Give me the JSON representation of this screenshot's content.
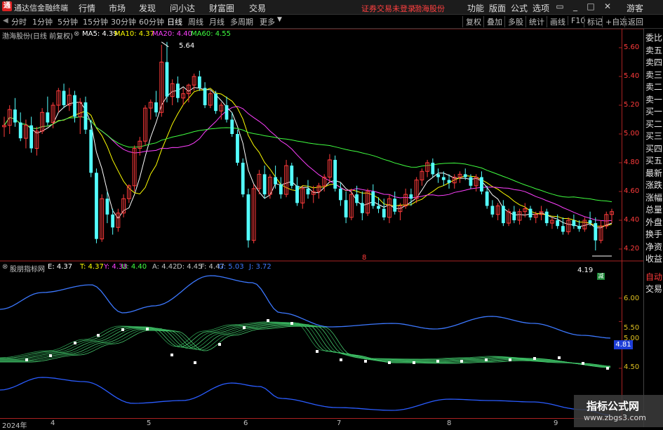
{
  "titlebar": {
    "logo": "通",
    "app_title": "通达信金融终端",
    "menus": [
      "行情",
      "市场",
      "发现",
      "问小达",
      "财富圈",
      "交易"
    ],
    "warning": "证券交易未登录",
    "stock_name": "渤海股份",
    "right_menus": [
      "功能",
      "版面",
      "公式",
      "选项"
    ],
    "guest": "游客"
  },
  "toolbar": {
    "periods": [
      "分时",
      "1分钟",
      "5分钟",
      "15分钟",
      "30分钟",
      "60分钟",
      "日线",
      "周线",
      "月线",
      "多周期",
      "更多"
    ],
    "active_period": "日线",
    "buttons": [
      "复权",
      "叠加",
      "多股",
      "统计",
      "画线",
      "F10",
      "标记",
      "+自选",
      "返回"
    ]
  },
  "main_chart": {
    "title": "渤海股份(日线 前复权)",
    "ma": [
      {
        "label": "MA5: 4.39",
        "color": "#ffffff"
      },
      {
        "label": "MA10: 4.37",
        "color": "#ffff00"
      },
      {
        "label": "MA20: 4.40",
        "color": "#ff40ff"
      },
      {
        "label": "MA60: 4.55",
        "color": "#40ff40"
      }
    ],
    "y_ticks": [
      "5.60",
      "5.40",
      "5.20",
      "5.00",
      "4.80",
      "4.60",
      "4.40",
      "4.20"
    ],
    "high_label": "5.64",
    "low_label": "4.19",
    "center_marker": "8"
  },
  "indicator": {
    "title": "股朋指标网",
    "values": [
      {
        "label": "E: 4.37",
        "color": "#ffffff"
      },
      {
        "label": "T: 4.37",
        "color": "#ffff00"
      },
      {
        "label": "Y: 4.38",
        "color": "#ff40ff"
      },
      {
        "label": "U: 4.40",
        "color": "#40ff40"
      },
      {
        "label": "A: 4.42",
        "color": "#c0c0c0"
      },
      {
        "label": "D: 4.45",
        "color": "#c0c0c0"
      },
      {
        "label": "F: 4.47",
        "color": "#c0c0c0"
      },
      {
        "label": "G: 5.03",
        "color": "#3c78ff"
      },
      {
        "label": "J: 3.72",
        "color": "#3c78ff"
      }
    ],
    "y_ticks": [
      "6.00",
      "5.50",
      "5.00",
      "4.50"
    ],
    "current": "4.81"
  },
  "right_panel": {
    "items": [
      "委比",
      "卖五",
      "卖四",
      "卖三",
      "卖二",
      "卖一",
      "买一",
      "买二",
      "买三",
      "买四",
      "买五",
      "最新",
      "涨跌",
      "涨幅",
      "总量",
      "外盘",
      "换手",
      "净资",
      "收益"
    ],
    "auto": "自动",
    "trade": "交易"
  },
  "dates": [
    {
      "label": "2024年"
    },
    {
      "label": "4"
    },
    {
      "label": "5"
    },
    {
      "label": "6"
    },
    {
      "label": "7"
    },
    {
      "label": "8"
    },
    {
      "label": "9"
    }
  ],
  "watermark": {
    "line1": "指标公式网",
    "line2": "www.zbgs3.com"
  },
  "candles": [
    [
      5.05,
      5.12,
      4.98,
      5.06
    ],
    [
      5.06,
      5.2,
      5.0,
      5.17
    ],
    [
      5.17,
      5.25,
      5.05,
      5.08
    ],
    [
      5.08,
      5.15,
      4.95,
      4.97
    ],
    [
      4.97,
      5.1,
      4.9,
      5.06
    ],
    [
      5.06,
      5.12,
      4.87,
      4.9
    ],
    [
      4.9,
      5.05,
      4.85,
      5.02
    ],
    [
      5.02,
      5.18,
      5.0,
      5.15
    ],
    [
      5.15,
      5.26,
      5.06,
      5.08
    ],
    [
      5.08,
      5.22,
      5.04,
      5.2
    ],
    [
      5.2,
      5.32,
      5.15,
      5.3
    ],
    [
      5.3,
      5.35,
      5.18,
      5.2
    ],
    [
      5.2,
      5.32,
      5.16,
      5.27
    ],
    [
      5.27,
      5.3,
      5.08,
      5.12
    ],
    [
      5.12,
      5.25,
      5.0,
      5.22
    ],
    [
      5.22,
      5.26,
      5.0,
      5.03
    ],
    [
      5.03,
      5.1,
      4.7,
      4.73
    ],
    [
      4.73,
      4.76,
      4.24,
      4.27
    ],
    [
      4.27,
      4.58,
      4.25,
      4.55
    ],
    [
      4.55,
      4.6,
      4.38,
      4.44
    ],
    [
      4.44,
      4.48,
      4.3,
      4.35
    ],
    [
      4.35,
      4.48,
      4.32,
      4.45
    ],
    [
      4.45,
      4.58,
      4.42,
      4.55
    ],
    [
      4.55,
      4.65,
      4.52,
      4.64
    ],
    [
      4.64,
      4.92,
      4.6,
      4.9
    ],
    [
      4.9,
      4.98,
      4.85,
      4.95
    ],
    [
      4.95,
      5.2,
      4.92,
      5.18
    ],
    [
      5.18,
      5.24,
      5.1,
      5.22
    ],
    [
      5.22,
      5.3,
      5.12,
      5.15
    ],
    [
      5.15,
      5.62,
      5.12,
      5.5
    ],
    [
      5.5,
      5.64,
      5.22,
      5.26
    ],
    [
      5.26,
      5.38,
      5.2,
      5.35
    ],
    [
      5.35,
      5.4,
      5.22,
      5.25
    ],
    [
      5.25,
      5.32,
      5.2,
      5.28
    ],
    [
      5.28,
      5.35,
      5.22,
      5.34
    ],
    [
      5.34,
      5.42,
      5.3,
      5.4
    ],
    [
      5.4,
      5.44,
      5.3,
      5.32
    ],
    [
      5.32,
      5.36,
      5.18,
      5.2
    ],
    [
      5.2,
      5.3,
      5.18,
      5.28
    ],
    [
      5.28,
      5.3,
      5.14,
      5.16
    ],
    [
      5.16,
      5.22,
      5.1,
      5.2
    ],
    [
      5.2,
      5.26,
      5.08,
      5.1
    ],
    [
      5.1,
      5.15,
      4.98,
      5.0
    ],
    [
      5.0,
      5.03,
      4.78,
      4.8
    ],
    [
      4.8,
      4.83,
      4.56,
      4.58
    ],
    [
      4.58,
      4.62,
      4.21,
      4.26
    ],
    [
      4.26,
      4.65,
      4.24,
      4.62
    ],
    [
      4.62,
      4.75,
      4.58,
      4.72
    ],
    [
      4.72,
      4.78,
      4.55,
      4.58
    ],
    [
      4.58,
      4.72,
      4.55,
      4.7
    ],
    [
      4.7,
      4.78,
      4.62,
      4.65
    ],
    [
      4.65,
      4.7,
      4.55,
      4.58
    ],
    [
      4.58,
      4.82,
      4.56,
      4.78
    ],
    [
      4.78,
      4.8,
      4.62,
      4.64
    ],
    [
      4.64,
      4.7,
      4.5,
      4.52
    ],
    [
      4.52,
      4.64,
      4.48,
      4.62
    ],
    [
      4.62,
      4.68,
      4.55,
      4.58
    ],
    [
      4.58,
      4.64,
      4.52,
      4.6
    ],
    [
      4.6,
      4.66,
      4.55,
      4.64
    ],
    [
      4.64,
      4.72,
      4.6,
      4.7
    ],
    [
      4.7,
      4.86,
      4.66,
      4.82
    ],
    [
      4.82,
      4.85,
      4.6,
      4.62
    ],
    [
      4.62,
      4.66,
      4.5,
      4.54
    ],
    [
      4.54,
      4.6,
      4.38,
      4.42
    ],
    [
      4.42,
      4.62,
      4.4,
      4.58
    ],
    [
      4.58,
      4.64,
      4.5,
      4.52
    ],
    [
      4.52,
      4.6,
      4.4,
      4.45
    ],
    [
      4.45,
      4.62,
      4.43,
      4.6
    ],
    [
      4.6,
      4.65,
      4.48,
      4.5
    ],
    [
      4.5,
      4.56,
      4.45,
      4.48
    ],
    [
      4.48,
      4.55,
      4.4,
      4.42
    ],
    [
      4.42,
      4.58,
      4.38,
      4.55
    ],
    [
      4.55,
      4.6,
      4.44,
      4.46
    ],
    [
      4.46,
      4.52,
      4.4,
      4.5
    ],
    [
      4.5,
      4.62,
      4.48,
      4.58
    ],
    [
      4.58,
      4.62,
      4.5,
      4.55
    ],
    [
      4.55,
      4.7,
      4.52,
      4.68
    ],
    [
      4.68,
      4.76,
      4.64,
      4.74
    ],
    [
      4.74,
      4.82,
      4.7,
      4.8
    ],
    [
      4.8,
      4.83,
      4.7,
      4.72
    ],
    [
      4.72,
      4.76,
      4.66,
      4.7
    ],
    [
      4.7,
      4.74,
      4.64,
      4.68
    ],
    [
      4.68,
      4.72,
      4.62,
      4.66
    ],
    [
      4.66,
      4.72,
      4.62,
      4.7
    ],
    [
      4.7,
      4.74,
      4.66,
      4.72
    ],
    [
      4.72,
      4.76,
      4.68,
      4.7
    ],
    [
      4.7,
      4.72,
      4.62,
      4.64
    ],
    [
      4.64,
      4.72,
      4.6,
      4.7
    ],
    [
      4.7,
      4.74,
      4.58,
      4.6
    ],
    [
      4.6,
      4.64,
      4.48,
      4.5
    ],
    [
      4.5,
      4.54,
      4.42,
      4.44
    ],
    [
      4.44,
      4.52,
      4.4,
      4.5
    ],
    [
      4.5,
      4.54,
      4.36,
      4.38
    ],
    [
      4.38,
      4.48,
      4.36,
      4.46
    ],
    [
      4.46,
      4.5,
      4.38,
      4.4
    ],
    [
      4.4,
      4.48,
      4.37,
      4.46
    ],
    [
      4.46,
      4.52,
      4.42,
      4.48
    ],
    [
      4.48,
      4.5,
      4.4,
      4.42
    ],
    [
      4.42,
      4.46,
      4.38,
      4.44
    ],
    [
      4.44,
      4.5,
      4.4,
      4.46
    ],
    [
      4.46,
      4.48,
      4.36,
      4.38
    ],
    [
      4.38,
      4.42,
      4.34,
      4.4
    ],
    [
      4.4,
      4.44,
      4.34,
      4.36
    ],
    [
      4.36,
      4.42,
      4.3,
      4.32
    ],
    [
      4.32,
      4.42,
      4.3,
      4.4
    ],
    [
      4.4,
      4.44,
      4.34,
      4.36
    ],
    [
      4.36,
      4.4,
      4.32,
      4.34
    ],
    [
      4.34,
      4.42,
      4.32,
      4.4
    ],
    [
      4.4,
      4.46,
      4.36,
      4.38
    ],
    [
      4.38,
      4.42,
      4.19,
      4.26
    ],
    [
      4.26,
      4.4,
      4.24,
      4.36
    ],
    [
      4.36,
      4.46,
      4.34,
      4.44
    ],
    [
      4.44,
      4.48,
      4.38,
      4.46
    ]
  ]
}
